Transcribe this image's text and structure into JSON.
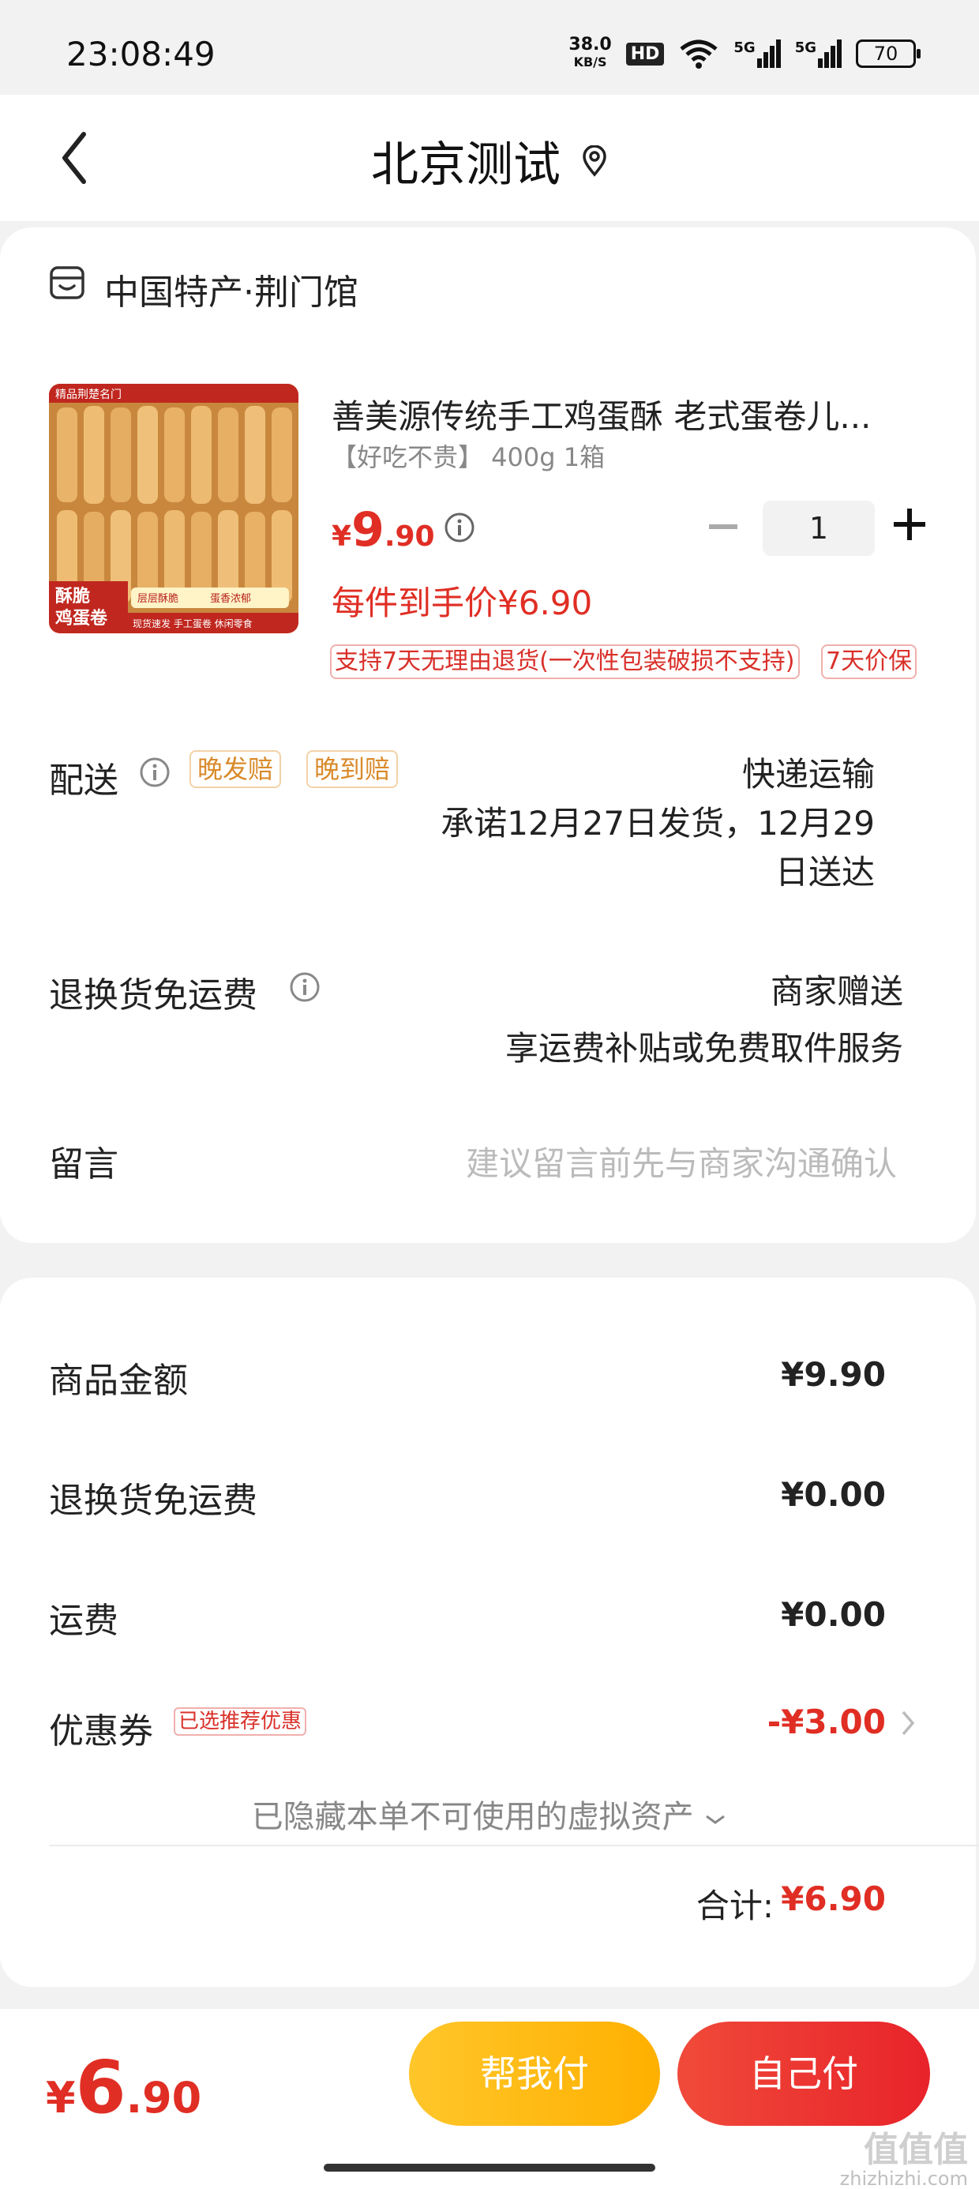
{
  "status_bar": {
    "time": "23:08:49",
    "net_speed_value": "38.0",
    "net_speed_unit": "KB/S",
    "hd_label": "HD",
    "signal_1": "5G",
    "signal_2": "5G",
    "battery": "70"
  },
  "header": {
    "title": "北京测试"
  },
  "shop": {
    "name": "中国特产·荆门馆"
  },
  "product": {
    "title": "善美源传统手工鸡蛋酥 老式蛋卷儿...",
    "spec": "【好吃不贵】 400g 1箱",
    "price_currency": "¥",
    "price_int": "9",
    "price_dec": ".90",
    "quantity": "1",
    "unit_price_label": "每件到手价¥6.90",
    "tags": [
      "支持7天无理由退货(一次性包装破损不支持)",
      "7天价保"
    ],
    "image_texts": {
      "brand_strip": "精品荆楚名门",
      "badge_line1": "酥脆",
      "badge_line2": "鸡蛋卷",
      "feature_1": "层层酥脆",
      "feature_2": "蛋香浓郁",
      "feature_3": "现货速发 手工蛋卷 休闲零食"
    }
  },
  "delivery": {
    "label": "配送",
    "tags": [
      "晚发赔",
      "晚到赔"
    ],
    "method": "快递运输",
    "promise_line1": "承诺12月27日发货，12月29",
    "promise_line2": "日送达"
  },
  "return_shipping": {
    "label": "退换货免运费",
    "value_line1": "商家赠送",
    "value_line2": "享运费补贴或免费取件服务"
  },
  "message": {
    "label": "留言",
    "placeholder": "建议留言前先与商家沟通确认"
  },
  "bill": {
    "goods_amount_label": "商品金额",
    "goods_amount": "¥9.90",
    "return_fee_label": "退换货免运费",
    "return_fee": "¥0.00",
    "shipping_label": "运费",
    "shipping": "¥0.00",
    "coupon_label": "优惠券",
    "coupon_tag": "已选推荐优惠",
    "coupon_value": "-¥3.00",
    "hidden_assets": "已隐藏本单不可使用的虚拟资产",
    "total_label": "合计:",
    "total_value": "¥6.90"
  },
  "bottom_bar": {
    "price_currency": "¥",
    "price_int": "6",
    "price_dec": ".90",
    "help_pay_label": "帮我付",
    "self_pay_label": "自己付"
  },
  "watermark": {
    "big": "值值值",
    "small": "zhizhizhi.com"
  },
  "colors": {
    "accent_red": "#e02e24",
    "help_button": "#ffbc1a",
    "self_button": "#ec3030",
    "tag_orange": "#d98a2a"
  }
}
